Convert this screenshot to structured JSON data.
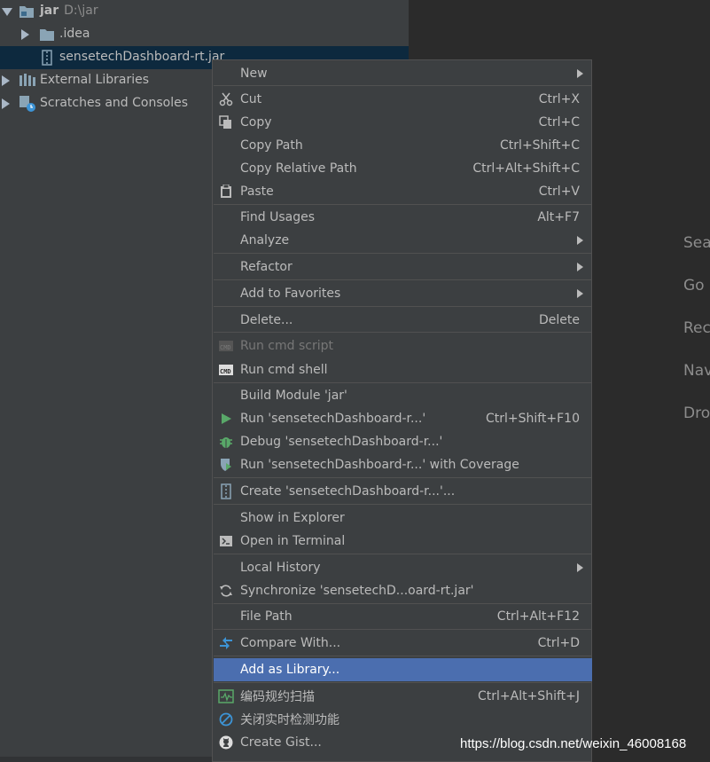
{
  "project_tree": {
    "root": {
      "label": "jar",
      "path": "D:\\jar"
    },
    "items": [
      {
        "label": ".idea"
      },
      {
        "label": "sensetechDashboard-rt.jar"
      },
      {
        "label": "External Libraries"
      },
      {
        "label": "Scratches and Consoles"
      }
    ]
  },
  "editor_hints": [
    "Sea",
    "Go",
    "Rec",
    "Nav",
    "Dro"
  ],
  "context_menu": {
    "items": [
      {
        "label": "New",
        "shortcut": ""
      },
      {
        "label": "Cut",
        "shortcut": "Ctrl+X",
        "icon": "scissors-icon"
      },
      {
        "label": "Copy",
        "shortcut": "Ctrl+C",
        "icon": "copy-icon"
      },
      {
        "label": "Copy Path",
        "shortcut": "Ctrl+Shift+C"
      },
      {
        "label": "Copy Relative Path",
        "shortcut": "Ctrl+Alt+Shift+C"
      },
      {
        "label": "Paste",
        "shortcut": "Ctrl+V",
        "icon": "clipboard-icon"
      },
      {
        "label": "Find Usages",
        "shortcut": "Alt+F7"
      },
      {
        "label": "Analyze",
        "shortcut": ""
      },
      {
        "label": "Refactor",
        "shortcut": ""
      },
      {
        "label": "Add to Favorites",
        "shortcut": ""
      },
      {
        "label": "Delete...",
        "shortcut": "Delete"
      },
      {
        "label": "Run cmd script",
        "shortcut": "",
        "icon": "cmd-script-icon"
      },
      {
        "label": "Run cmd shell",
        "shortcut": "",
        "icon": "cmd-shell-icon"
      },
      {
        "label": "Build Module 'jar'",
        "shortcut": ""
      },
      {
        "label": "Run 'sensetechDashboard-r...'",
        "shortcut": "Ctrl+Shift+F10",
        "icon": "run-icon"
      },
      {
        "label": "Debug 'sensetechDashboard-r...'",
        "shortcut": "",
        "icon": "debug-icon"
      },
      {
        "label": "Run 'sensetechDashboard-r...' with Coverage",
        "shortcut": "",
        "icon": "coverage-icon"
      },
      {
        "label": "Create 'sensetechDashboard-r...'...",
        "shortcut": "",
        "icon": "jar-config-icon"
      },
      {
        "label": "Show in Explorer",
        "shortcut": ""
      },
      {
        "label": "Open in Terminal",
        "shortcut": "",
        "icon": "terminal-icon"
      },
      {
        "label": "Local History",
        "shortcut": ""
      },
      {
        "label": "Synchronize 'sensetechD...oard-rt.jar'",
        "shortcut": "",
        "icon": "sync-icon"
      },
      {
        "label": "File Path",
        "shortcut": "Ctrl+Alt+F12"
      },
      {
        "label": "Compare With...",
        "shortcut": "Ctrl+D",
        "icon": "compare-icon"
      },
      {
        "label": "Add as Library...",
        "shortcut": ""
      },
      {
        "label": "编码规约扫描",
        "shortcut": "Ctrl+Alt+Shift+J",
        "icon": "code-scan-icon"
      },
      {
        "label": "关闭实时检测功能",
        "shortcut": "",
        "icon": "disable-icon"
      },
      {
        "label": "Create Gist...",
        "shortcut": "",
        "icon": "github-icon"
      }
    ]
  },
  "watermark": "https://blog.csdn.net/weixin_46008168",
  "colors": {
    "background": "#2b2b2b",
    "panel": "#3c3f41",
    "highlight": "#4b6eaf",
    "text": "#bbbbbb",
    "disabled_text": "#777777",
    "selected_row": "#0d293e"
  }
}
